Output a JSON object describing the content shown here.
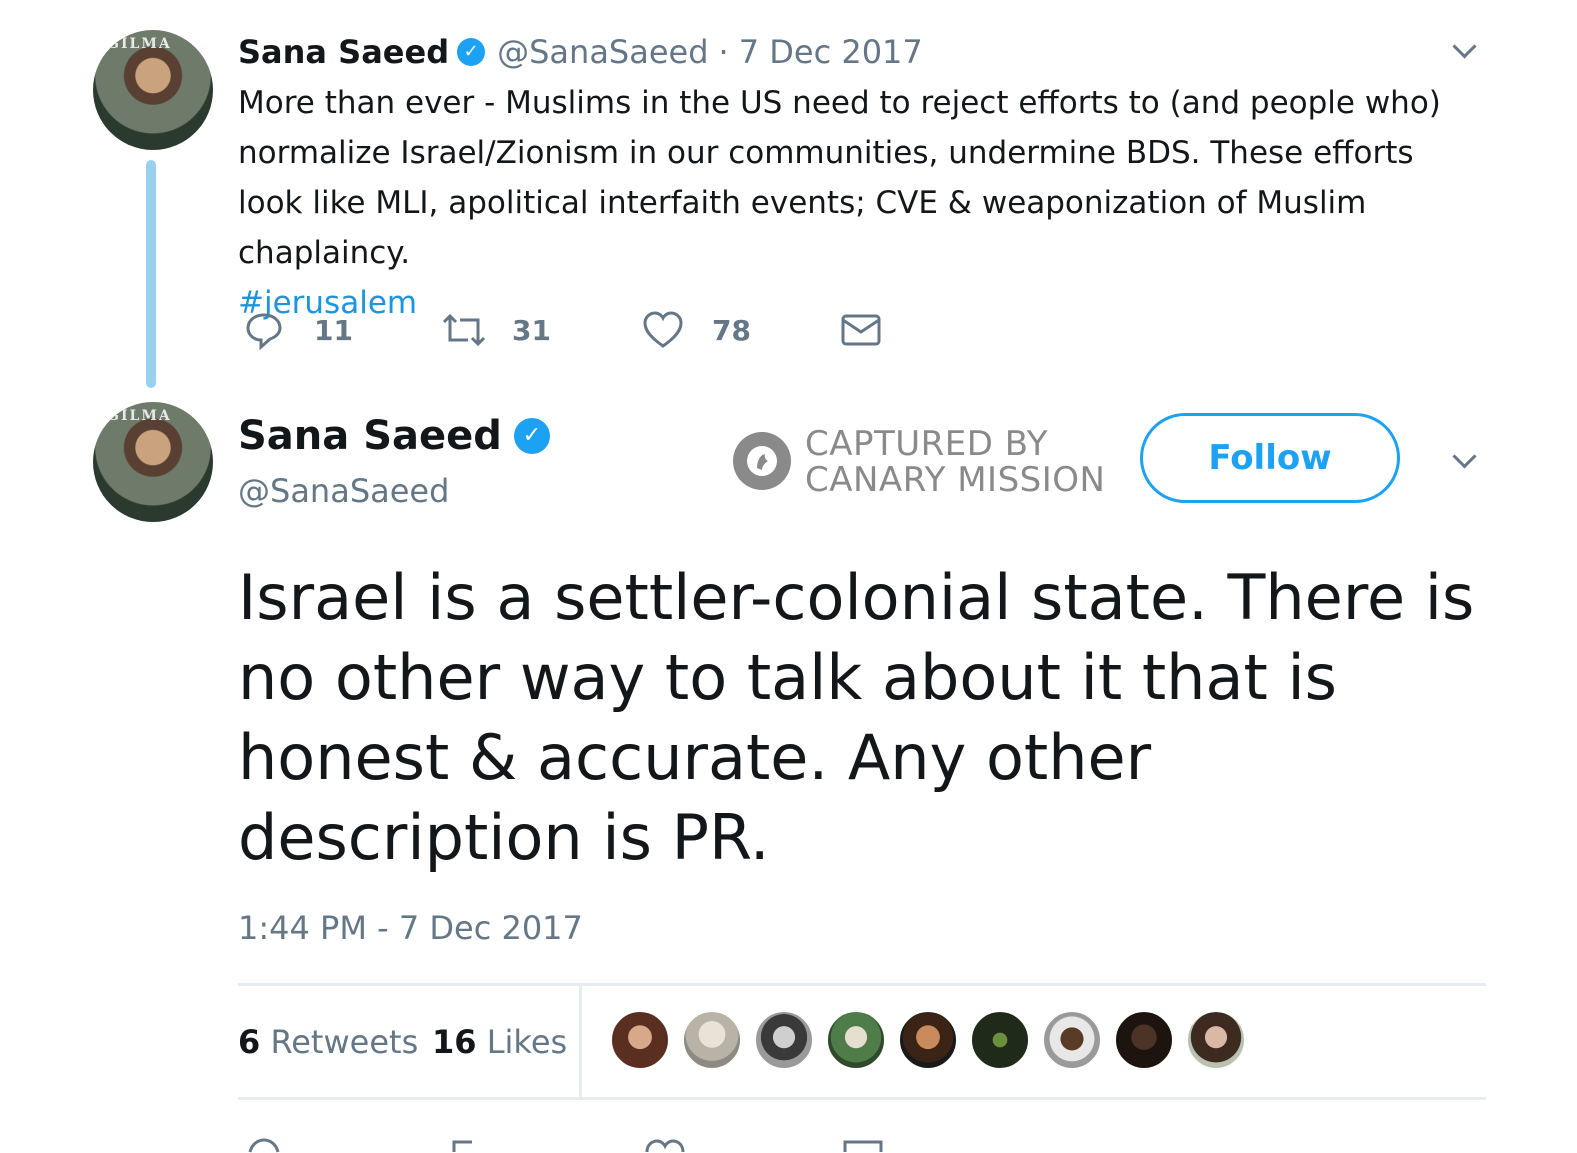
{
  "parent_tweet": {
    "display_name": "Sana Saeed",
    "handle": "@SanaSaeed",
    "separator": "·",
    "date": "7 Dec 2017",
    "text": "More than ever - Muslims in the US need to reject efforts to (and people who) normalize Israel/Zionism in our communities, undermine BDS. These efforts look like MLI, apolitical interfaith events; CVE & weaponization of Muslim chaplaincy.",
    "hashtag": "#jerusalem",
    "avatar_banner": "GILMA",
    "actions": {
      "replies": "11",
      "retweets": "31",
      "likes": "78"
    }
  },
  "main_tweet": {
    "display_name": "Sana Saeed",
    "handle": "@SanaSaeed",
    "avatar_banner": "GILMA",
    "text": "Israel is a settler-colonial state. There is no other way to talk about it that is honest & accurate. Any other description is PR.",
    "timestamp": "1:44 PM - 7 Dec 2017",
    "follow_label": "Follow",
    "watermark": {
      "line1": "CAPTURED BY",
      "line2": "CANARY MISSION"
    },
    "stats": {
      "retweets_count": "6",
      "retweets_label": "Retweets",
      "likes_count": "16",
      "likes_label": "Likes"
    }
  },
  "colors": {
    "accent": "#1da1f2",
    "link": "#1b95e0",
    "muted": "#657786",
    "thread_line": "#9ad0ef",
    "divider": "#e6ecf0"
  },
  "icons": [
    "verified-badge-icon",
    "reply-icon",
    "retweet-icon",
    "heart-icon",
    "mail-icon",
    "chevron-down-icon",
    "canary-bird-icon"
  ]
}
